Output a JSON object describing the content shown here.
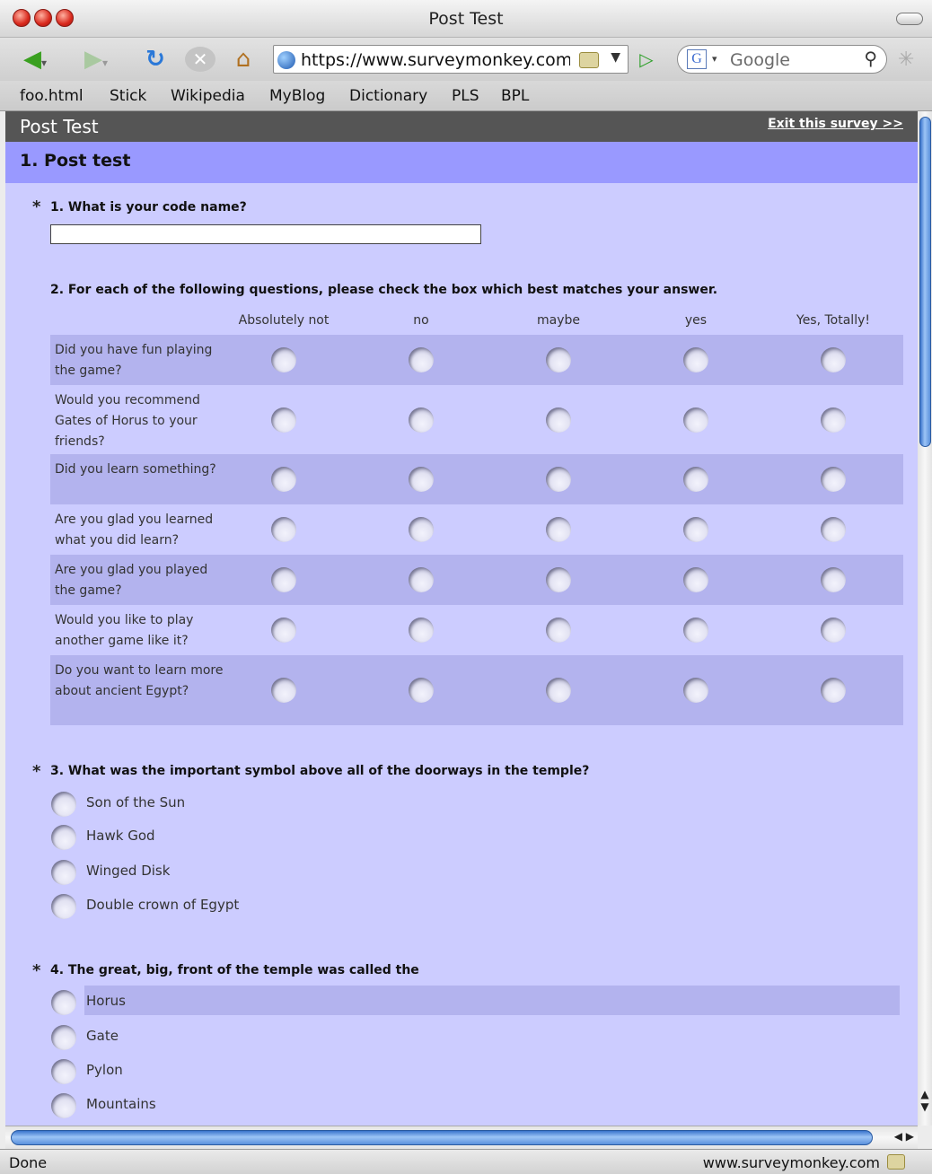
{
  "window": {
    "title": "Post Test"
  },
  "toolbar": {
    "url": "https://www.surveymonkey.com/s",
    "search_engine": "Google",
    "icons": [
      "back-arrow-icon",
      "forward-arrow-icon",
      "reload-icon",
      "stop-icon",
      "home-icon",
      "globe-icon",
      "lock-icon",
      "go-arrow-icon",
      "google-icon",
      "magnifier-icon",
      "spinner-icon"
    ]
  },
  "bookmarks": [
    "foo.html",
    "Stick",
    "Wikipedia",
    "MyBlog",
    "Dictionary",
    "PLS",
    "BPL"
  ],
  "survey": {
    "title": "Post Test",
    "exit_label": "Exit this survey >>",
    "page_title": "1. Post test"
  },
  "q1": {
    "text": "1. What is your code name?",
    "value": ""
  },
  "q2": {
    "text": "2. For each of the following questions, please check the box which best matches your answer.",
    "columns": [
      "Absolutely not",
      "no",
      "maybe",
      "yes",
      "Yes, Totally!"
    ],
    "rows": [
      "Did you have fun playing the game?",
      "Would you recommend Gates of Horus to your friends?",
      "Did you learn something?",
      "Are you glad you learned what you did learn?",
      "Are you glad you played the game?",
      "Would you like to play another game like it?",
      "Do you want to learn more about ancient Egypt?"
    ]
  },
  "q3": {
    "text": "3. What was the important symbol above all of the doorways in the temple?",
    "options": [
      "Son of the Sun",
      "Hawk God",
      "Winged Disk",
      "Double crown of Egypt"
    ]
  },
  "q4": {
    "text": "4. The great, big, front of the temple was called the",
    "options": [
      "Horus",
      "Gate",
      "Pylon",
      "Mountains"
    ]
  },
  "required_marker": "*",
  "status": {
    "text": "Done",
    "domain": "www.surveymonkey.com"
  },
  "colors": {
    "page_bg": "#ccccff",
    "page_bar": "#9999ff",
    "header_bg": "#555555",
    "row_shade": "#b3b3ee"
  }
}
